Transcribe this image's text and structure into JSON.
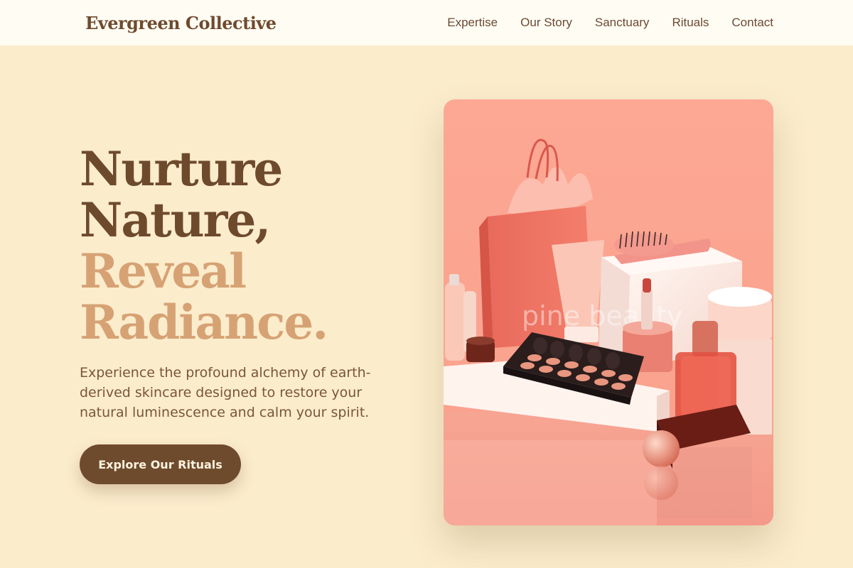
{
  "header": {
    "brand": "Evergreen Collective",
    "nav": [
      "Expertise",
      "Our Story",
      "Sanctuary",
      "Rituals",
      "Contact"
    ]
  },
  "hero": {
    "title_dark": [
      "Nurture",
      "Nature,"
    ],
    "title_light": [
      "Reveal",
      "Radiance."
    ],
    "description": "Experience the profound alchemy of earth-derived skincare designed to restore your natural luminescence and calm your spirit.",
    "cta_label": "Explore Our Rituals",
    "image_watermark": "pine beauty"
  },
  "colors": {
    "page_bg": "#fbeccc",
    "header_bg": "#fffcf4",
    "brand_dark": "#6f4a2e",
    "accent_light": "#d6a274",
    "button_bg": "#6f4b2d",
    "image_bg": "#fba592"
  }
}
